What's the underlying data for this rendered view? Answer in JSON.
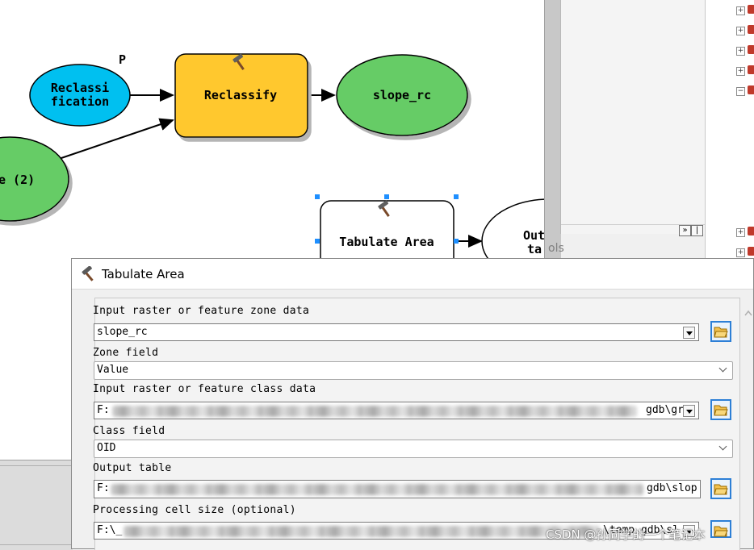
{
  "model": {
    "nodes": {
      "reclassification_param": "Reclassi\nfication",
      "reclassification_param_line1": "Reclassi",
      "reclassification_param_line2": "fication",
      "param_marker": "P",
      "reclassify_tool": "Reclassify",
      "slope_rc_output": "slope_rc",
      "partial_input": "e (2)",
      "tabulate_area_tool": "Tabulate Area",
      "output_table_line1": "Out",
      "output_table_line2": "ta"
    },
    "colors": {
      "parameter_blue": "#00c0f0",
      "tool_yellow": "#ffc82e",
      "data_green": "#66cc66",
      "selection_handle": "#1e8fff"
    }
  },
  "side_panel": {
    "tools_label": "ols"
  },
  "dialog": {
    "title": "Tabulate Area",
    "fields": {
      "zone_data": {
        "label": "Input raster or feature zone data",
        "value": "slope_rc"
      },
      "zone_field": {
        "label": "Zone field",
        "value": "Value"
      },
      "class_data": {
        "label": "Input raster or feature class data",
        "value_start": "F:",
        "value_end": "gdb\\gr"
      },
      "class_field": {
        "label": "Class field",
        "value": "OID"
      },
      "output_table": {
        "label": "Output table",
        "value_start": "F:",
        "value_end": "gdb\\slop"
      },
      "cell_size": {
        "label": "Processing cell size (optional)",
        "value_start": "F:\\_",
        "value_end": "\\temp.gdb\\sl"
      }
    }
  },
  "watermark": "CSDN @孙同学的一个笔记本"
}
